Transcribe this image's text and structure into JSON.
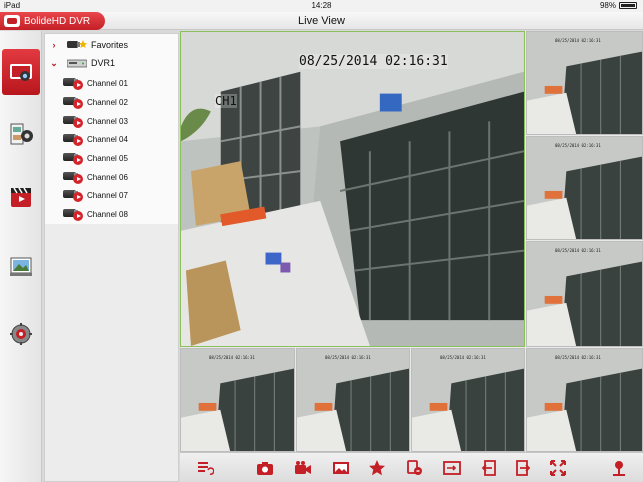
{
  "status_bar": {
    "device": "iPad",
    "time": "14:28",
    "battery": "98%"
  },
  "app": {
    "name": "BolideHD DVR",
    "title": "Live View"
  },
  "accent": "#c41f26",
  "rail": [
    {
      "name": "live-view-icon",
      "active": true
    },
    {
      "name": "playback-icon",
      "active": false
    },
    {
      "name": "video-files-icon",
      "active": false
    },
    {
      "name": "pictures-icon",
      "active": false
    },
    {
      "name": "settings-icon",
      "active": false
    }
  ],
  "tree": {
    "favorites": "Favorites",
    "device": "DVR1",
    "channels": [
      "Channel 01",
      "Channel 02",
      "Channel 03",
      "Channel 04",
      "Channel 05",
      "Channel 06",
      "Channel 07",
      "Channel 08"
    ]
  },
  "video": {
    "main_timestamp": "08/25/2014 02:16:31",
    "main_channel": "CH1",
    "thumb_timestamp": "08/25/2014 02:16:31"
  },
  "toolbar": [
    "view-list-icon",
    "snapshot-icon",
    "record-icon",
    "album-icon",
    "favorite-star-icon",
    "stream-switch-icon",
    "layout-icon",
    "previous-page-icon",
    "next-page-icon",
    "fullscreen-icon",
    "ptz-icon"
  ]
}
